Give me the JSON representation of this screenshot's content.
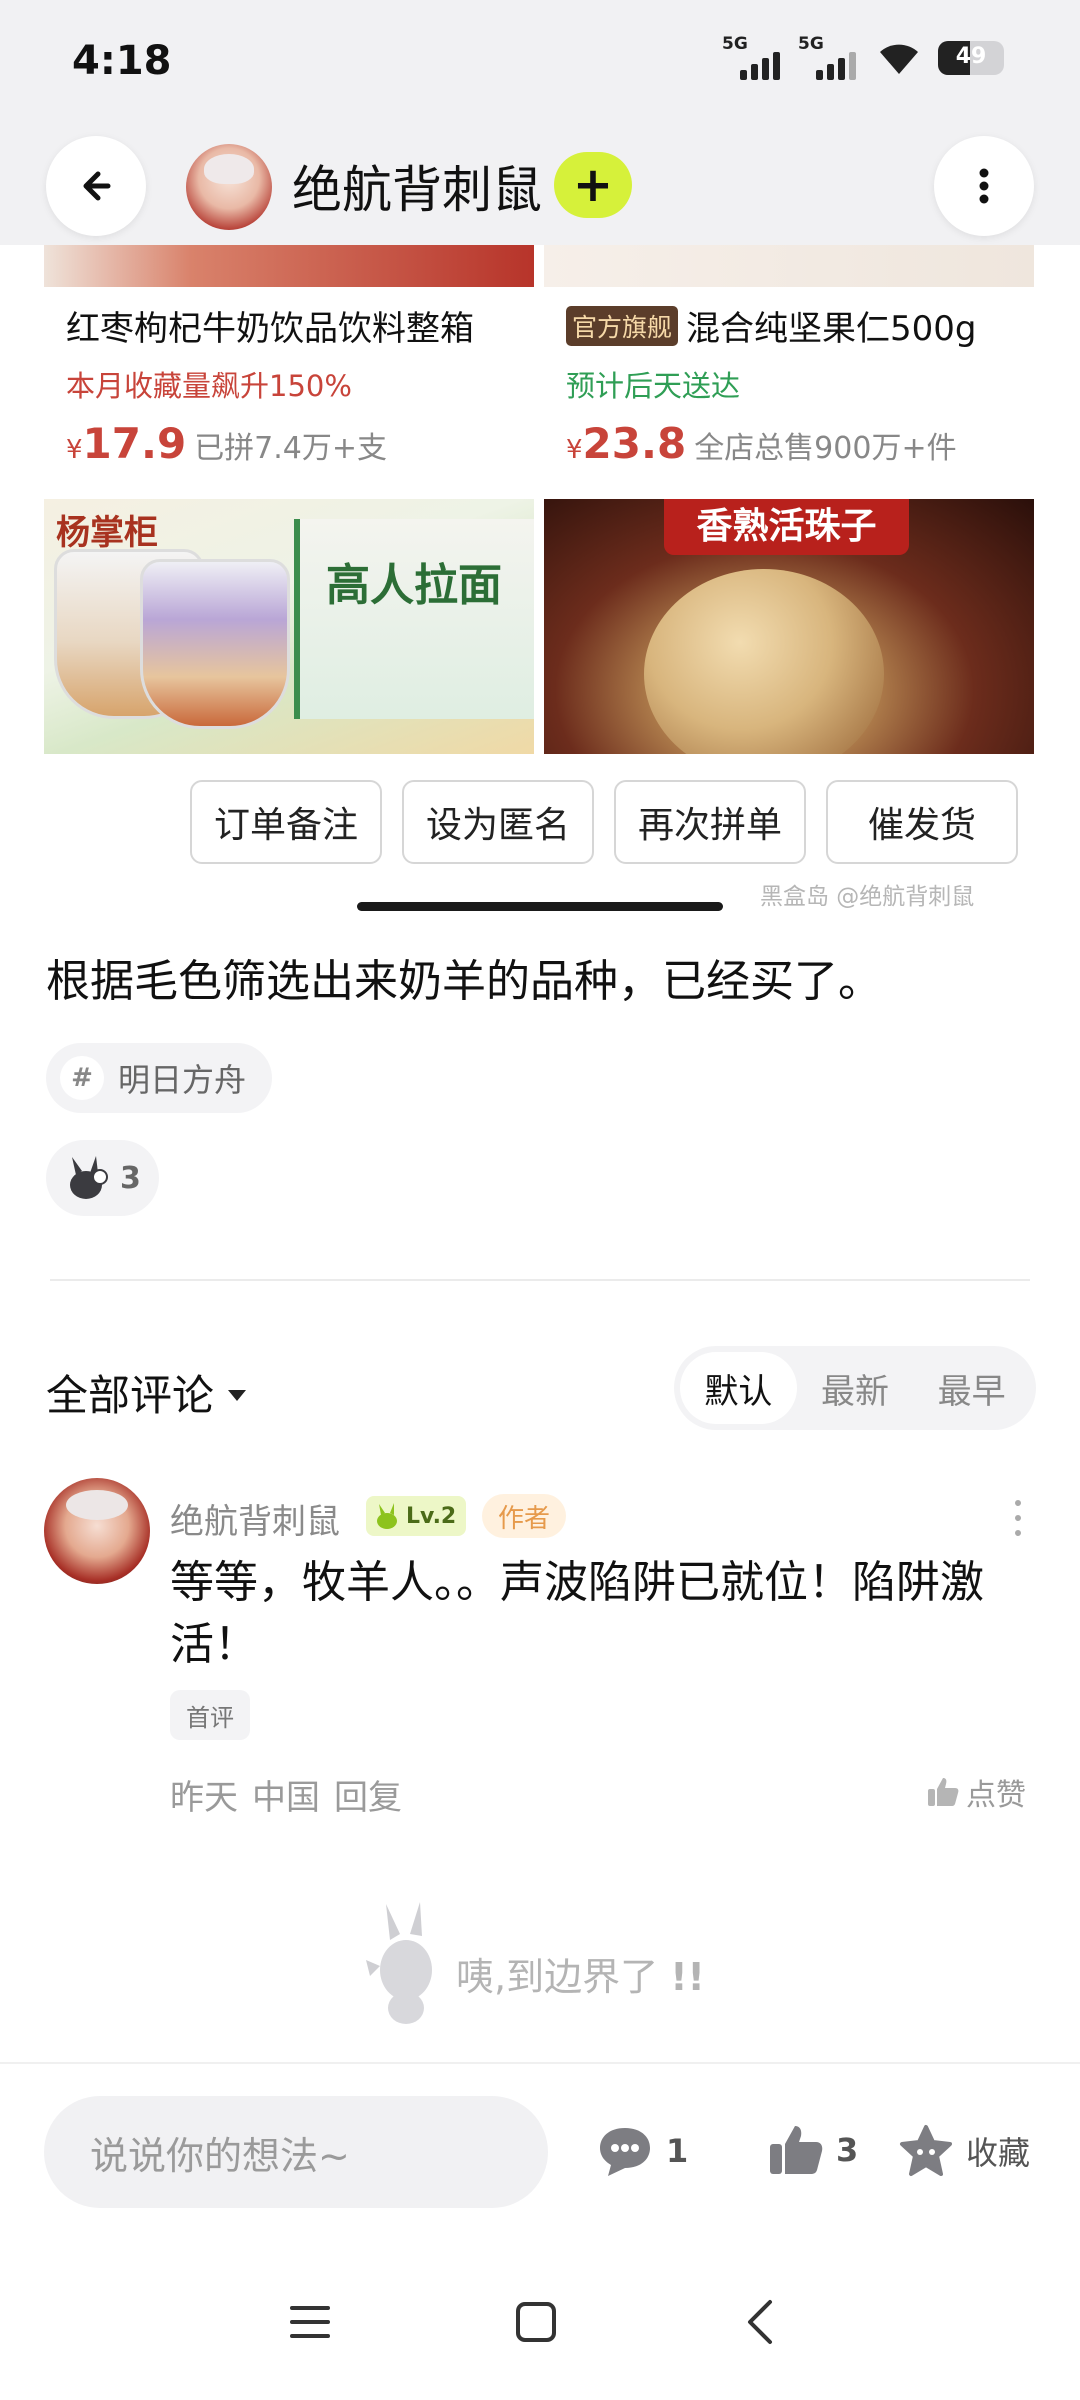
{
  "status_bar": {
    "time": "4:18",
    "network1": "5G",
    "network2": "5G",
    "battery": "49"
  },
  "header": {
    "author_name": "绝航背刺鼠",
    "follow_symbol": "+"
  },
  "products": [
    {
      "title": "红枣枸杞牛奶饮品饮料整箱",
      "badge": "",
      "subtitle": "本月收藏量飙升150%",
      "subtitle_color": "#c8443a",
      "currency": "¥",
      "price": "17.9",
      "meta": "已拼7.4万+支"
    },
    {
      "title": "混合纯坚果仁500g",
      "badge": "官方旗舰",
      "subtitle": "预计后天送达",
      "subtitle_color": "#2f9e55",
      "currency": "¥",
      "price": "23.8",
      "meta": "全店总售900万+件"
    }
  ],
  "product_images": {
    "brand_mark": "杨掌柜",
    "noodle_text": "高人拉面",
    "egg_banner": "香熟活珠子"
  },
  "order_actions": [
    "订单备注",
    "设为匿名",
    "再次拼单",
    "催发货"
  ],
  "watermark": "黑盒岛 @绝航背刺鼠",
  "post": {
    "text": "根据毛色筛选出来奶羊的品种，已经买了。",
    "topic": "明日方舟",
    "reaction_count": "3"
  },
  "comments": {
    "title": "全部评论",
    "sort_tabs": [
      "默认",
      "最新",
      "最早"
    ],
    "active_sort": "默认",
    "items": [
      {
        "author": "绝航背刺鼠",
        "level": "Lv.2",
        "role_badge": "作者",
        "text": "等等，牧羊人。。声波陷阱已就位！陷阱激活！",
        "tag": "首评",
        "time": "昨天",
        "location": "中国",
        "reply": "回复",
        "like_label": "点赞"
      }
    ],
    "end_text": "咦,到边界了"
  },
  "bottom_bar": {
    "input_placeholder": "说说你的想法~",
    "comment_count": "1",
    "like_count": "3",
    "favorite_label": "收藏"
  },
  "colors": {
    "accent": "#d6f13a",
    "price_red": "#c8443a",
    "green": "#2f9e55"
  },
  "icons": [
    "back-arrow-icon",
    "more-vertical-icon",
    "plus-icon",
    "hash-icon",
    "rabbit-reaction-icon",
    "caret-down-icon",
    "thumb-up-icon",
    "comment-bubble-icon",
    "star-face-icon",
    "menu-icon",
    "home-square-icon",
    "back-chevron-icon"
  ]
}
